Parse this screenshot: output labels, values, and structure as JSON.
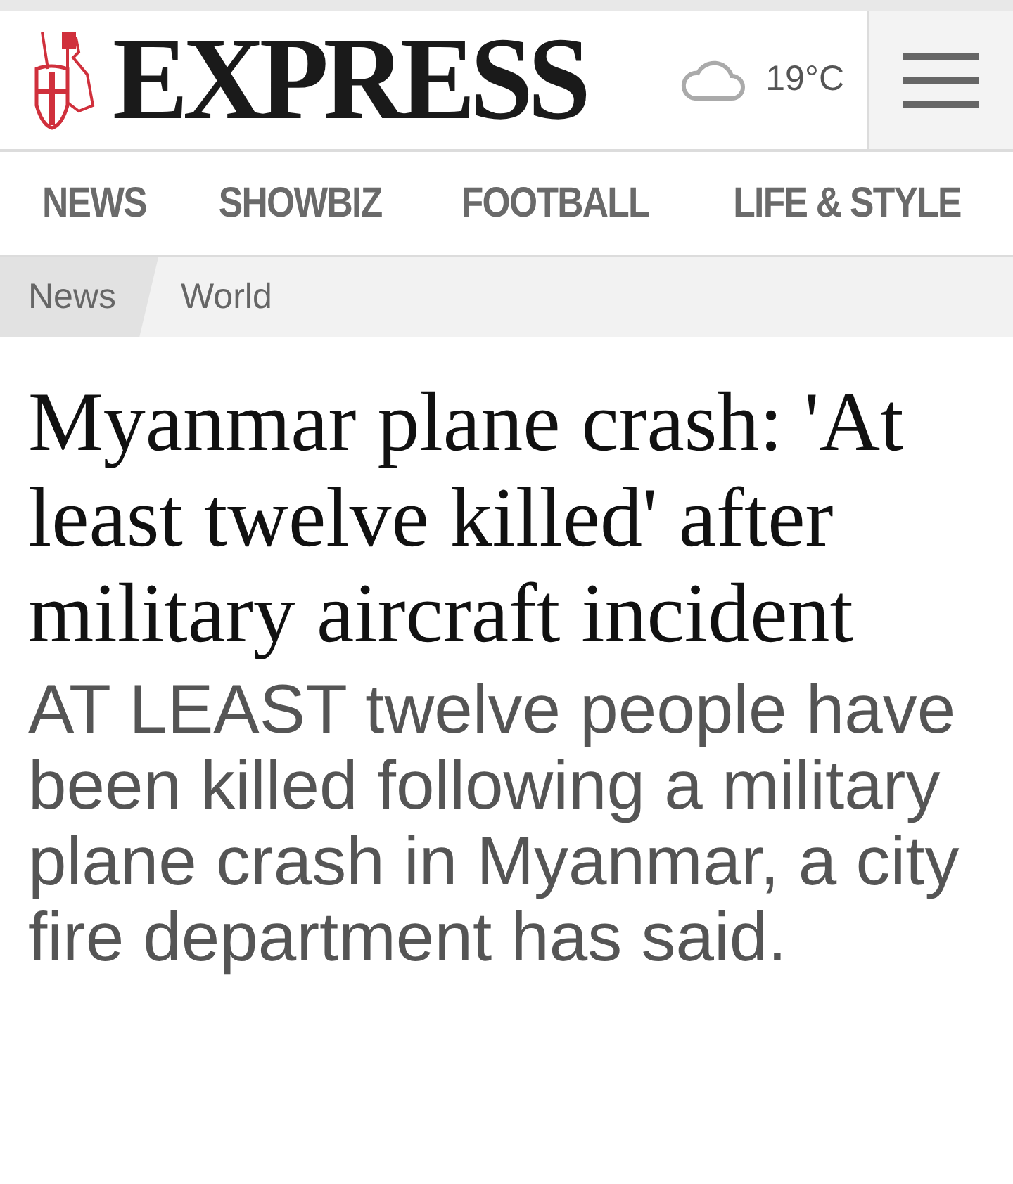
{
  "header": {
    "logo": "EXPRESS",
    "temperature": "19°C"
  },
  "nav": [
    {
      "label": "NEWS"
    },
    {
      "label": "SHOWBIZ"
    },
    {
      "label": "FOOTBALL"
    },
    {
      "label": "LIFE & STYLE"
    }
  ],
  "breadcrumbs": [
    {
      "label": "News"
    },
    {
      "label": "World"
    }
  ],
  "article": {
    "headline": "Myanmar plane crash: 'At least twelve killed' after military aircraft incident",
    "standfirst": "AT LEAST twelve people have been killed following a military plane crash in Myanmar, a city fire department has said."
  }
}
